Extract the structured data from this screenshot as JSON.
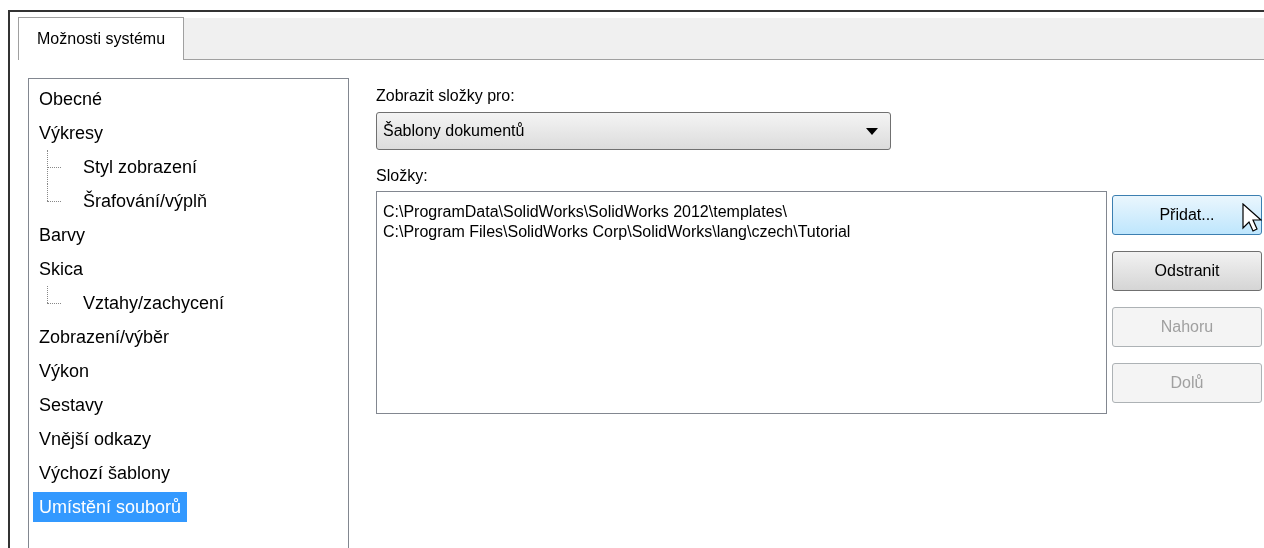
{
  "tabs": [
    {
      "label": "Možnosti systému",
      "selected": true
    }
  ],
  "tree": [
    {
      "label": "Obecné",
      "selected": false
    },
    {
      "label": "Výkresy",
      "selected": false,
      "children": [
        {
          "label": "Styl zobrazení",
          "selected": false
        },
        {
          "label": "Šrafování/výplň",
          "selected": false
        }
      ]
    },
    {
      "label": "Barvy",
      "selected": false
    },
    {
      "label": "Skica",
      "selected": false,
      "children": [
        {
          "label": "Vztahy/zachycení",
          "selected": false
        }
      ]
    },
    {
      "label": "Zobrazení/výběr",
      "selected": false
    },
    {
      "label": "Výkon",
      "selected": false
    },
    {
      "label": "Sestavy",
      "selected": false
    },
    {
      "label": "Vnější odkazy",
      "selected": false
    },
    {
      "label": "Výchozí šablony",
      "selected": false
    },
    {
      "label": "Umístění souborů",
      "selected": true
    }
  ],
  "folder_type": {
    "label": "Zobrazit složky pro:",
    "value": "Šablony dokumentů"
  },
  "folders": {
    "label": "Složky:",
    "items": [
      "C:\\ProgramData\\SolidWorks\\SolidWorks 2012\\templates\\",
      "C:\\Program Files\\SolidWorks Corp\\SolidWorks\\lang\\czech\\Tutorial"
    ]
  },
  "buttons": [
    {
      "label": "Přidat...",
      "hovered": true,
      "disabled": false
    },
    {
      "label": "Odstranit",
      "hovered": false,
      "disabled": false
    },
    {
      "label": "Nahoru",
      "hovered": false,
      "disabled": true
    },
    {
      "label": "Dolů",
      "hovered": false,
      "disabled": true
    }
  ]
}
